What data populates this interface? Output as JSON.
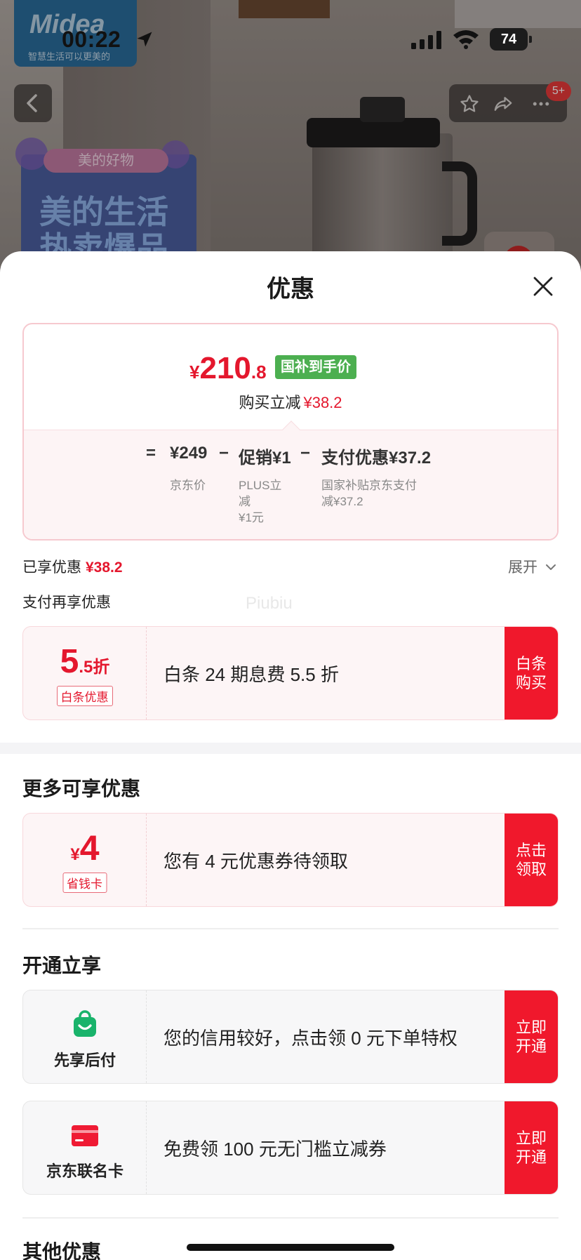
{
  "status_bar": {
    "time": "00:22",
    "battery": "74"
  },
  "background": {
    "brand_name": "Midea",
    "brand_slogan": "智慧生活可以更美的",
    "promo_tag": "美的好物",
    "promo_title_line1": "美的生活",
    "promo_title_line2": "热卖爆品",
    "message_badge": "5+"
  },
  "sheet": {
    "title": "优惠",
    "price_card": {
      "currency": "¥",
      "price_int": "210",
      "price_dec": ".8",
      "badge": "国补到手价",
      "reduce_label": "购买立减",
      "reduce_value": "¥38.2",
      "formula": {
        "equals": "=",
        "minus": "−",
        "jd_price": "¥249",
        "jd_price_label": "京东价",
        "promo": "促销¥1",
        "promo_label_line1": "PLUS立",
        "promo_label_line2": "减",
        "promo_label_line3": "¥1元",
        "pay": "支付优惠¥37.2",
        "pay_label_line1": "国家补贴京东支付",
        "pay_label_line2": "减¥37.2"
      }
    },
    "enjoyed_label": "已享优惠",
    "enjoyed_value": "¥38.2",
    "expand_label": "展开",
    "pay_more_label": "支付再享优惠",
    "watermark": "Piubiu",
    "baitiao": {
      "big_int": "5",
      "big_suffix": ".5折",
      "tag": "白条优惠",
      "text": "白条 24 期息费 5.5 折",
      "action_line1": "白条",
      "action_line2": "购买"
    },
    "more_title": "更多可享优惠",
    "coupon": {
      "currency": "¥",
      "amount": "4",
      "tag": "省钱卡",
      "text": "您有 4 元优惠券待领取",
      "action_line1": "点击",
      "action_line2": "领取"
    },
    "open_title": "开通立享",
    "pay_later": {
      "label": "先享后付",
      "text": "您的信用较好，点击领 0 元下单特权",
      "action_line1": "立即",
      "action_line2": "开通"
    },
    "jd_card": {
      "label": "京东联名卡",
      "text": "免费领 100 元无门槛立减券",
      "action_line1": "立即",
      "action_line2": "开通"
    },
    "other_title": "其他优惠"
  },
  "colors": {
    "accent_red": "#e4172d",
    "action_red": "#f0182c",
    "green_badge": "#4caf50",
    "pay_later_green": "#19b36b"
  }
}
